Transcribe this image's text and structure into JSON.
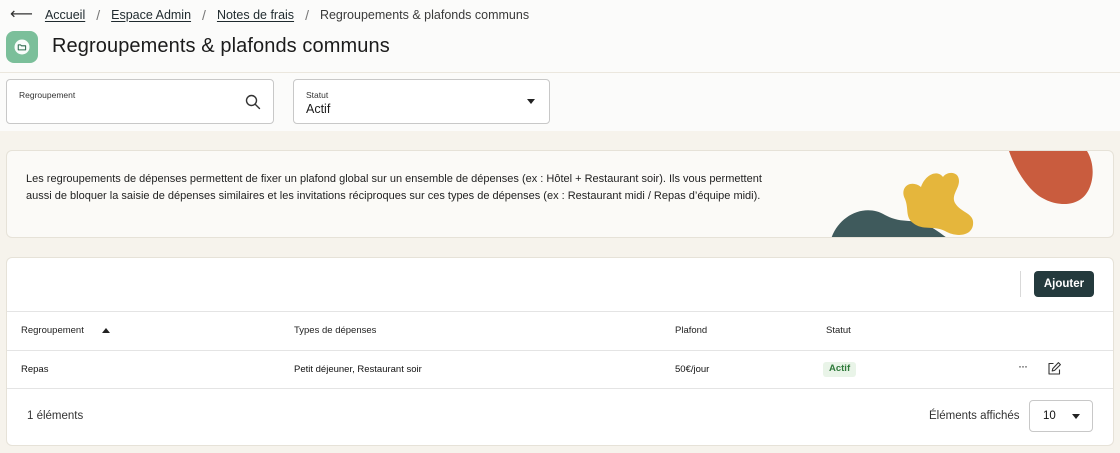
{
  "breadcrumb": {
    "items": [
      "Accueil",
      "Espace Admin",
      "Notes de frais"
    ],
    "current": "Regroupements & plafonds communs"
  },
  "page": {
    "title": "Regroupements & plafonds communs",
    "icon": "folder-icon",
    "icon_color": "#7bbf9a"
  },
  "filters": {
    "grouping": {
      "label": "Regroupement",
      "value": ""
    },
    "status": {
      "label": "Statut",
      "value": "Actif"
    }
  },
  "info": {
    "text": "Les regroupements de dépenses permettent de fixer un plafond global sur un ensemble de dépenses (ex : Hôtel + Restaurant soir). Ils vous permettent aussi de bloquer la saisie de dépenses similaires et les invitations réciproques sur ces types de dépenses (ex : Restaurant midi / Repas d’équipe midi)."
  },
  "table": {
    "add_label": "Ajouter",
    "columns": [
      "Regroupement",
      "Types de dépenses",
      "Plafond",
      "Statut"
    ],
    "rows": [
      {
        "name": "Repas",
        "types": "Petit déjeuner, Restaurant soir",
        "limit": "50€/jour",
        "status": "Actif"
      }
    ],
    "more_label": "···",
    "count_label": "1 éléments",
    "page_size_label": "Éléments affichés",
    "page_size": "10"
  },
  "colors": {
    "primary_dark": "#243a3d",
    "badge_bg": "#e9f4e8",
    "badge_text": "#2f7a3b",
    "illustration_orange": "#c95c3e",
    "illustration_yellow": "#e5b63c",
    "illustration_teal": "#3f5a5c"
  }
}
